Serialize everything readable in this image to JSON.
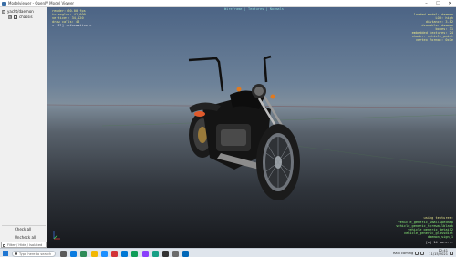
{
  "window": {
    "title": "Modelviewer - OpenIV Model Viewer",
    "controls": [
      "–",
      "☐",
      "✕"
    ]
  },
  "sidebar": {
    "tree": [
      {
        "label": "yacht/daemon",
        "expander": "⊟",
        "checked": null,
        "indent": 0
      },
      {
        "label": "chassis",
        "expander": "⊞",
        "checked": true,
        "indent": 1
      }
    ],
    "check_all_label": "Check all",
    "uncheck_all_label": "Uncheck all",
    "filter_placeholder": "Filter / Hide / Isolated"
  },
  "viewport": {
    "top_left": [
      "render: 60.00 fps",
      "triangles: 41,600",
      "vertices: 34,120",
      "draw calls: 48",
      "< [F1] information >"
    ],
    "top_center": "Wireframe | Textures | Normals",
    "top_right": [
      "loaded model: daemon",
      "LOD: high",
      "distance: 3.82",
      "drawable: daemon",
      "bones: 31",
      "embedded textures: 24",
      "shader: vehicle_paint",
      "vertex format: 0x7e"
    ],
    "bottom_right_header": "using textures:",
    "bottom_right": [
      "vehicle_generic_smallspecmap",
      "vehicle_generic_tyrewallblack",
      "vehicle_generic_detail2",
      "vehicle_generic_glassdirt",
      "daemon_sign_1",
      "[+] 14 more..."
    ]
  },
  "taskbar": {
    "search_placeholder": "Type here to search",
    "weather": "Rain coming",
    "time": "12:41",
    "date": "11/15/2021",
    "icon_colors": [
      "#5a5a5a",
      "#0a7be0",
      "#2e8b57",
      "#f2b705",
      "#1e90ff",
      "#d13438",
      "#0078d4",
      "#0f9d58",
      "#8a3ffc",
      "#16a085",
      "#333333",
      "#6b6b6b",
      "#0067b8"
    ]
  }
}
